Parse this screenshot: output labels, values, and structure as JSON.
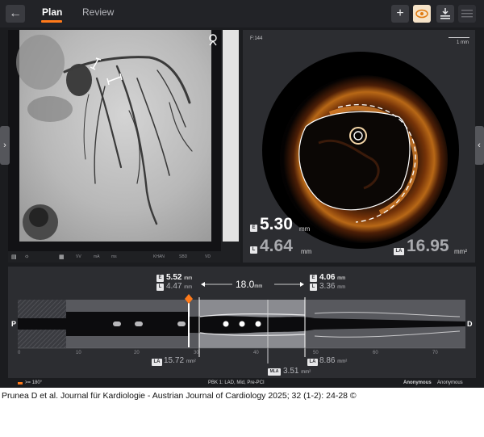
{
  "tabs": {
    "plan": "Plan",
    "review": "Review"
  },
  "toolbar": {
    "back_icon": "arrow-left-icon",
    "add": "+",
    "eye_icon": "eye-icon",
    "export_icon": "download-icon",
    "menu_icon": "menu-icon"
  },
  "angio": {
    "bottom_labels": [
      "VV",
      "mA",
      "ms",
      "KHAN",
      "SBD",
      "VD"
    ],
    "icons": [
      "ruler-icon",
      "sun-icon",
      "settings-icon"
    ]
  },
  "oct": {
    "frame": "F:144",
    "scale": "1 mm",
    "ees_value": "5.30",
    "ees_unit": "mm",
    "lumen_value": "4.64",
    "lumen_unit": "mm",
    "lumen_area_value": "16.95",
    "lumen_area_unit": "mm²",
    "badge_e": "E",
    "badge_l": "L",
    "badge_la": "LA"
  },
  "longitudinal": {
    "prox_e_value": "5.52",
    "prox_e_unit": "mm",
    "prox_l_value": "4.47",
    "prox_l_unit": "mm",
    "length_value": "18.0",
    "length_unit": "mm",
    "dist_e_value": "4.06",
    "dist_e_unit": "mm",
    "dist_l_value": "3.36",
    "dist_l_unit": "mm",
    "prox_area_value": "15.72",
    "prox_area_unit": "mm²",
    "mla_label": "MLA",
    "mla_value": "3.51",
    "mla_unit": "mm²",
    "dist_area_value": "8.86",
    "dist_area_unit": "mm²",
    "p_label": "P",
    "d_label": "D",
    "ticks": [
      "0",
      "10",
      "20",
      "30",
      "40",
      "50",
      "60",
      "70"
    ]
  },
  "footer": {
    "legend": ">= 180°",
    "pullback": "PBK 1: LAD, Mid, Pre-PCI",
    "patient_name": "Anonymous",
    "patient_id": "Anonymous"
  },
  "citation": "Prunea D et al. Journal für Kardiologie - Austrian Journal of Cardiology 2025; 32 (1-2): 24-28 ©",
  "colors": {
    "accent": "#ff7a1a",
    "panel": "#2c2d31",
    "background": "#1b1c1f"
  }
}
